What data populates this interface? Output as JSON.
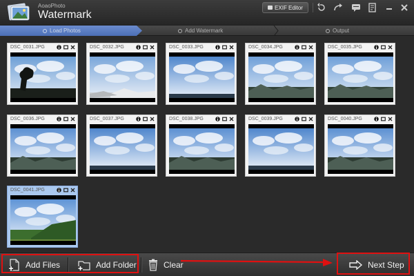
{
  "app": {
    "brand_small": "AoaoPhoto",
    "brand_name": "Watermark"
  },
  "toolbar": {
    "exif_label": "EXIF Editor",
    "icons": [
      "undo-icon",
      "share-icon",
      "chat-icon",
      "notes-icon",
      "minimize-icon",
      "close-icon"
    ]
  },
  "steps": [
    {
      "label": "Load Photos",
      "active": true
    },
    {
      "label": "Add Watermark",
      "active": false
    },
    {
      "label": "Output",
      "active": false
    }
  ],
  "photos": [
    {
      "name": "DSC_0031.JPG",
      "selected": false,
      "variant": "tree"
    },
    {
      "name": "DSC_0032.JPG",
      "selected": false,
      "variant": "rocks"
    },
    {
      "name": "DSC_0033.JPG",
      "selected": false,
      "variant": "clouds"
    },
    {
      "name": "DSC_0034.JPG",
      "selected": false,
      "variant": "hills"
    },
    {
      "name": "DSC_0035.JPG",
      "selected": false,
      "variant": "hills"
    },
    {
      "name": "DSC_0036.JPG",
      "selected": false,
      "variant": "mountain"
    },
    {
      "name": "DSC_0037.JPG",
      "selected": false,
      "variant": "clouds"
    },
    {
      "name": "DSC_0038.JPG",
      "selected": false,
      "variant": "mountain"
    },
    {
      "name": "DSC_0039.JPG",
      "selected": false,
      "variant": "clouds"
    },
    {
      "name": "DSC_0040.JPG",
      "selected": false,
      "variant": "mountain"
    },
    {
      "name": "DSC_0041.JPG",
      "selected": true,
      "variant": "greenhill"
    }
  ],
  "bottom": {
    "add_files": "Add Files",
    "add_folder": "Add Folder",
    "clear": "Clear",
    "next_step": "Next Step"
  },
  "colors": {
    "accent": "#5577bb",
    "highlight": "#e01010",
    "selected_card": "#aac8ee"
  }
}
